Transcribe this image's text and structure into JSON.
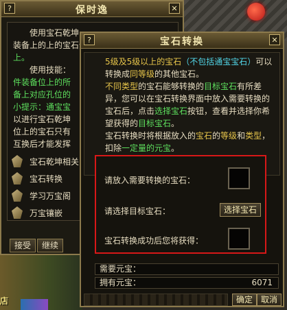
{
  "background": {
    "shop_sign": "店"
  },
  "left_window": {
    "title": "保时逸",
    "help_icon": "?",
    "close_icon": "✕",
    "para1": "使用宝石乾坤可以将装备上的上的宝石全部拆除下来并放入包裹中。",
    "para1_lines": [
      "使用宝石乾坤",
      "装备上的上的宝石全",
      "上。"
    ],
    "para2_lines": [
      "使用技能：",
      "件装备位上的所",
      "备上对应孔位的",
      "小提示：通宝宝",
      "以进行宝石乾坤",
      "位上的宝石只有",
      "互换后才能发挥"
    ],
    "items": [
      {
        "label": "宝石乾坤相关",
        "icon": "gem-icon"
      },
      {
        "label": "宝石转换",
        "icon": "gem-icon"
      },
      {
        "label": "学习万宝阁",
        "icon": "gem-icon"
      },
      {
        "label": "万宝镶嵌",
        "icon": "gem-icon"
      }
    ],
    "accept_button": "接受",
    "continue_button": "继续"
  },
  "dialog": {
    "title": "宝石转换",
    "help_icon": "?",
    "close_icon": "✕",
    "desc": {
      "p1_a": "5级及5级以上的宝石",
      "p1_b": "（不包括通宝宝石）",
      "p1_c": "可以转换成",
      "p1_d": "同等级",
      "p1_e": "的其他宝石。",
      "p2_a": "不同类型",
      "p2_b": "的宝石能够转换的",
      "p2_c": "目标宝石",
      "p2_d": "有所差异，您可以在宝石转换界面中放入需要转换的宝石后，点击",
      "p2_e": "选择宝石",
      "p2_f": "按钮，查看并选择你希望获得的",
      "p2_g": "目标宝石",
      "p2_h": "。",
      "p3_a": "宝石转换时将根据放入的",
      "p3_b": "宝石",
      "p3_c": "的",
      "p3_d": "等级",
      "p3_e": "和",
      "p3_f": "类型",
      "p3_g": "，扣除",
      "p3_h": "一定量的元宝",
      "p3_i": "。"
    },
    "put_gem_label": "请放入需要转换的宝石：",
    "select_target_label": "请选择目标宝石：",
    "select_gem_button": "选择宝石",
    "result_label": "宝石转换成功后您将获得：",
    "required_yuanbao_label": "需要元宝：",
    "required_yuanbao_value": "",
    "owned_yuanbao_label": "拥有元宝：",
    "owned_yuanbao_value": "6071",
    "confirm_button": "确定",
    "cancel_button": "取消"
  }
}
